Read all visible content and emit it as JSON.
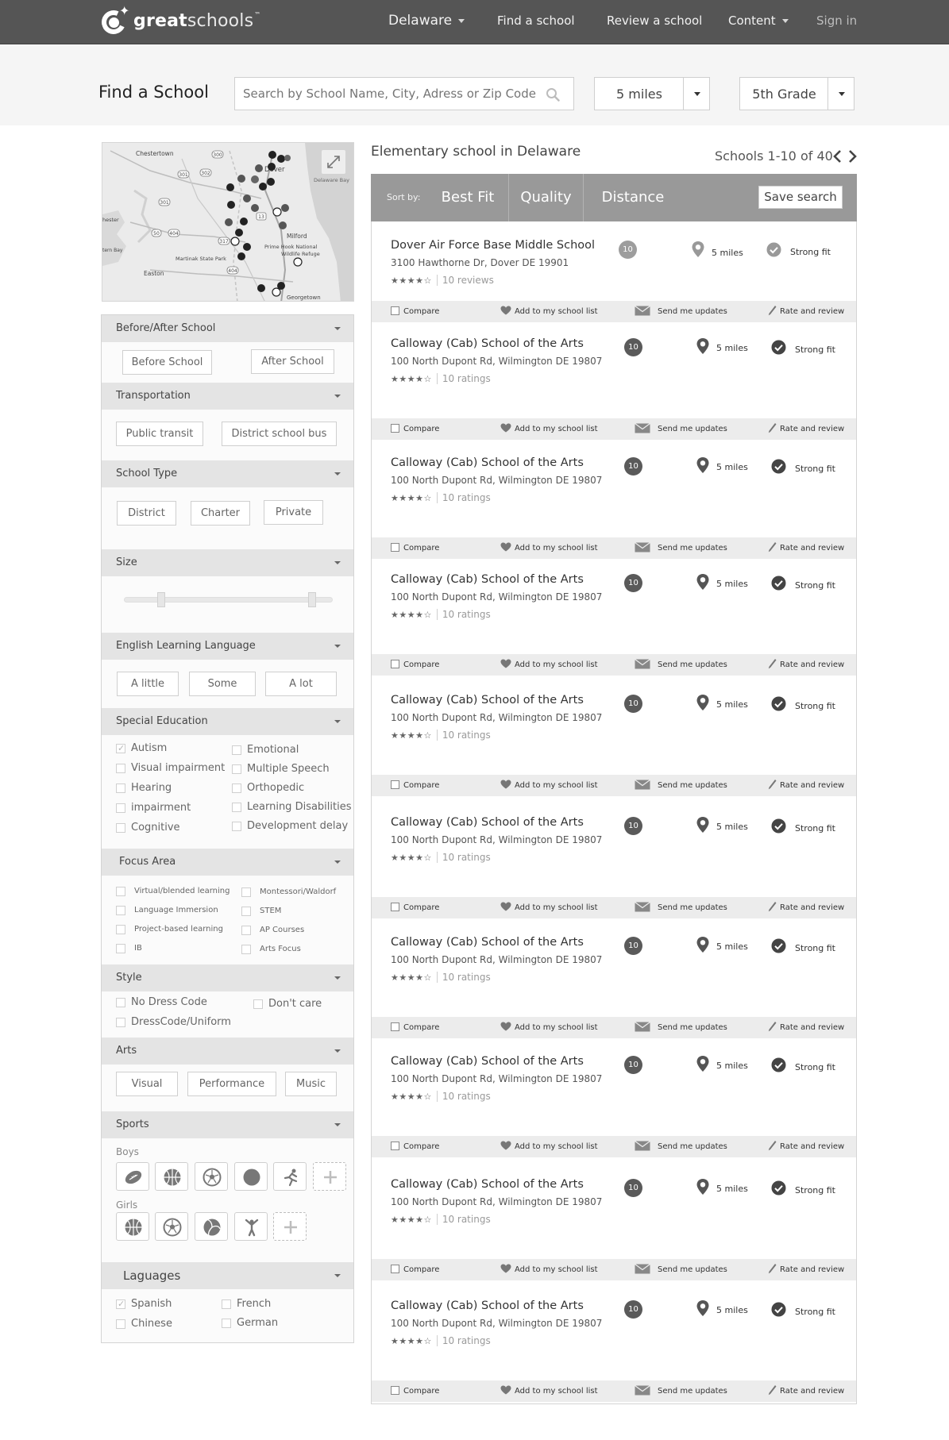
{
  "nav": {
    "logo_bold": "great",
    "logo_light": "schools",
    "logo_tm": "™",
    "state": "Delaware",
    "find": "Find a school",
    "review": "Review a school",
    "content": "Content",
    "signin": "Sign in"
  },
  "search": {
    "title": "Find a School",
    "placeholder": "Search by School Name, City, Adress or Zip Code",
    "distance": "5 miles",
    "grade": "5th Grade"
  },
  "map": {
    "labels": {
      "chestertown": "Chestertown",
      "dover": "Dover",
      "delaware_bay": "Delaware Bay",
      "milford": "Milford",
      "prime_hook": "Prime Hook National",
      "wildlife_refuge": "Wildlife Refuge",
      "martinak": "Martinak State Park",
      "easton": "Easton",
      "georgetown": "Georgetown",
      "chester": "hester",
      "tern_bay": "tern Bay",
      "r300": "300",
      "r301": "301",
      "r302": "302",
      "r13": "13",
      "r50": "50",
      "r404": "404",
      "r317": "317"
    }
  },
  "filters": {
    "before_after": {
      "title": "Before/After School",
      "options": [
        "Before School",
        "After School"
      ]
    },
    "transportation": {
      "title": "Transportation",
      "options": [
        "Public transit",
        "District school bus"
      ]
    },
    "school_type": {
      "title": "School Type",
      "options": [
        "District",
        "Charter",
        "Private"
      ]
    },
    "size": {
      "title": "Size",
      "range_low": 0.18,
      "range_high": 0.9
    },
    "ell": {
      "title": "English Learning Language",
      "options": [
        "A little",
        "Some",
        "A lot"
      ]
    },
    "special_ed": {
      "title": "Special Education",
      "left": [
        {
          "label": "Autism",
          "checked": true
        },
        {
          "label": "Visual impairment",
          "checked": false
        },
        {
          "label": "Hearing",
          "checked": false
        },
        {
          "label": "impairment",
          "checked": false
        },
        {
          "label": "Cognitive",
          "checked": false
        }
      ],
      "right": [
        {
          "label": "Emotional",
          "checked": false
        },
        {
          "label": "Multiple Speech",
          "checked": false
        },
        {
          "label": "Orthopedic",
          "checked": false
        },
        {
          "label": "Learning Disabilities",
          "checked": false
        },
        {
          "label": "Development delay",
          "checked": false
        }
      ]
    },
    "focus_area": {
      "title": "Focus Area",
      "left": [
        "Virtual/blended learning",
        "Language Immersion",
        "Project-based learning",
        "IB"
      ],
      "right": [
        "Montessori/Waldorf",
        "STEM",
        "AP Courses",
        "Arts Focus"
      ]
    },
    "style": {
      "title": "Style",
      "options": [
        "No Dress Code",
        "Don't care",
        "DressCode/Uniform"
      ]
    },
    "arts": {
      "title": "Arts",
      "options": [
        "Visual",
        "Performance",
        "Music"
      ]
    },
    "sports": {
      "title": "Sports",
      "boys_label": "Boys",
      "girls_label": "Girls",
      "boys_icons": [
        "football-icon",
        "basketball-icon",
        "soccer-icon",
        "baseball-icon",
        "track-icon",
        "add-icon"
      ],
      "girls_icons": [
        "basketball-icon",
        "soccer-icon",
        "volleyball-icon",
        "cheerleading-icon",
        "add-icon"
      ]
    },
    "languages": {
      "title": "Laguages",
      "options": [
        {
          "label": "Spanish",
          "checked": true
        },
        {
          "label": "French",
          "checked": false
        },
        {
          "label": "Chinese",
          "checked": false
        },
        {
          "label": "German",
          "checked": false
        }
      ]
    }
  },
  "results": {
    "title": "Elementary school in Delaware",
    "count": "Schools 1-10 of 40",
    "sort_label": "Sort by:",
    "sort_options": [
      "Best Fit",
      "Quality",
      "Distance"
    ],
    "save_search": "Save search",
    "actions": {
      "compare": "Compare",
      "add_list": "Add to my school list",
      "updates": "Send me updates",
      "rate": "Rate and review"
    },
    "schools": [
      {
        "name": "Dover Air Force Base Middle School",
        "address": "3100 Hawthorne Dr, Dover  DE 19901",
        "stars": "★★★★☆",
        "reviews": "10 reviews",
        "rating": "10",
        "distance": "5 miles",
        "fit": "Strong fit"
      },
      {
        "name": "Calloway (Cab) School of the Arts",
        "address": "100 North Dupont Rd, Wilmington DE 19807",
        "stars": "★★★★☆",
        "reviews": "10 ratings",
        "rating": "10",
        "distance": "5 miles",
        "fit": "Strong fit"
      },
      {
        "name": "Calloway (Cab) School of the Arts",
        "address": "100 North Dupont Rd, Wilmington DE 19807",
        "stars": "★★★★☆",
        "reviews": "10 ratings",
        "rating": "10",
        "distance": "5 miles",
        "fit": "Strong fit"
      },
      {
        "name": "Calloway (Cab) School of the Arts",
        "address": "100 North Dupont Rd, Wilmington DE 19807",
        "stars": "★★★★☆",
        "reviews": "10 ratings",
        "rating": "10",
        "distance": "5 miles",
        "fit": "Strong fit"
      },
      {
        "name": "Calloway (Cab) School of the Arts",
        "address": "100 North Dupont Rd, Wilmington DE 19807",
        "stars": "★★★★☆",
        "reviews": "10 ratings",
        "rating": "10",
        "distance": "5 miles",
        "fit": "Strong fit"
      },
      {
        "name": "Calloway (Cab) School of the Arts",
        "address": "100 North Dupont Rd, Wilmington DE 19807",
        "stars": "★★★★☆",
        "reviews": "10 ratings",
        "rating": "10",
        "distance": "5 miles",
        "fit": "Strong fit"
      },
      {
        "name": "Calloway (Cab) School of the Arts",
        "address": "100 North Dupont Rd, Wilmington DE 19807",
        "stars": "★★★★☆",
        "reviews": "10 ratings",
        "rating": "10",
        "distance": "5 miles",
        "fit": "Strong fit"
      },
      {
        "name": "Calloway (Cab) School of the Arts",
        "address": "100 North Dupont Rd, Wilmington DE 19807",
        "stars": "★★★★☆",
        "reviews": "10 ratings",
        "rating": "10",
        "distance": "5 miles",
        "fit": "Strong fit"
      },
      {
        "name": "Calloway (Cab) School of the Arts",
        "address": "100 North Dupont Rd, Wilmington DE 19807",
        "stars": "★★★★☆",
        "reviews": "10 ratings",
        "rating": "10",
        "distance": "5 miles",
        "fit": "Strong fit"
      },
      {
        "name": "Calloway (Cab) School of the Arts",
        "address": "100 North Dupont Rd, Wilmington DE 19807",
        "stars": "★★★★☆",
        "reviews": "10 ratings",
        "rating": "10",
        "distance": "5 miles",
        "fit": "Strong fit"
      }
    ]
  }
}
